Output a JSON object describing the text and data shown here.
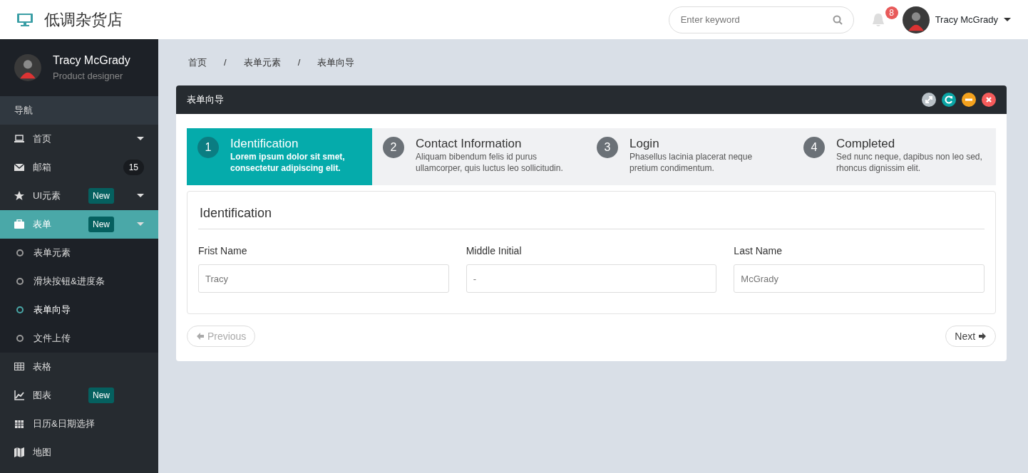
{
  "brand": "低调杂货店",
  "header": {
    "search": {
      "placeholder": "Enter keyword"
    },
    "notifications": "8",
    "user": "Tracy McGrady"
  },
  "sidebar": {
    "user": {
      "name": "Tracy McGrady",
      "role": "Product designer"
    },
    "section": "导航",
    "items": [
      {
        "label": "首页",
        "submenu": true,
        "selected": false
      },
      {
        "label": "邮箱",
        "count": "15",
        "submenu": false,
        "selected": false
      },
      {
        "label": "UI元素",
        "badge": "New",
        "submenu": true,
        "selected": false
      },
      {
        "label": "表单",
        "badge": "New",
        "submenu": true,
        "selected": true,
        "children": [
          {
            "label": "表单元素",
            "selected": false
          },
          {
            "label": "滑块按钮&进度条",
            "selected": false
          },
          {
            "label": "表单向导",
            "selected": true
          },
          {
            "label": "文件上传",
            "selected": false
          }
        ]
      },
      {
        "label": "表格",
        "submenu": false,
        "selected": false
      },
      {
        "label": "图表",
        "badge": "New",
        "submenu": false,
        "selected": false
      },
      {
        "label": "日历&日期选择",
        "submenu": false,
        "selected": false
      },
      {
        "label": "地图",
        "submenu": false,
        "selected": false
      }
    ]
  },
  "breadcrumb": {
    "separator": "/",
    "items": [
      "首页",
      "表单元素",
      "表单向导"
    ]
  },
  "panel": {
    "title": "表单向导",
    "steps": [
      {
        "number": "1",
        "title": "Identification",
        "text": "Lorem ipsum dolor sit smet, consectetur adipiscing elit.",
        "selected": true
      },
      {
        "number": "2",
        "title": "Contact Information",
        "text": "Aliquam bibendum felis id purus ullamcorper, quis luctus leo sollicitudin.",
        "selected": false
      },
      {
        "number": "3",
        "title": "Login",
        "text": "Phasellus lacinia placerat neque pretium condimentum.",
        "selected": false
      },
      {
        "number": "4",
        "title": "Completed",
        "text": "Sed nunc neque, dapibus non leo sed, rhoncus dignissim elit.",
        "selected": false
      }
    ],
    "section_title": "Identification",
    "fields": [
      {
        "label": "Frist Name",
        "placeholder": "Tracy"
      },
      {
        "label": "Middle Initial",
        "placeholder": "-"
      },
      {
        "label": "Last Name",
        "placeholder": "McGrady"
      }
    ],
    "previous": {
      "label": "Previous",
      "disabled": true
    },
    "next": {
      "label": "Next",
      "disabled": false
    }
  }
}
